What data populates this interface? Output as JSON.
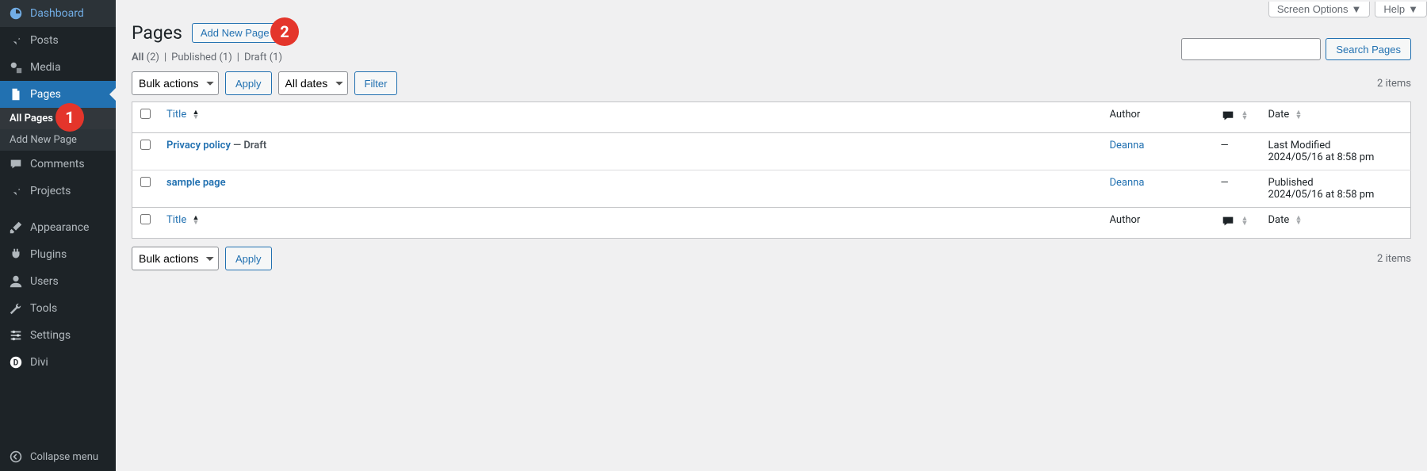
{
  "sidebar": {
    "items": [
      {
        "id": "dashboard",
        "label": "Dashboard",
        "icon": "dashboard-icon"
      },
      {
        "id": "posts",
        "label": "Posts",
        "icon": "pin-icon"
      },
      {
        "id": "media",
        "label": "Media",
        "icon": "media-icon"
      },
      {
        "id": "pages",
        "label": "Pages",
        "icon": "page-icon"
      },
      {
        "id": "comments",
        "label": "Comments",
        "icon": "comment-icon"
      },
      {
        "id": "projects",
        "label": "Projects",
        "icon": "pin-icon"
      },
      {
        "id": "appearance",
        "label": "Appearance",
        "icon": "brush-icon"
      },
      {
        "id": "plugins",
        "label": "Plugins",
        "icon": "plug-icon"
      },
      {
        "id": "users",
        "label": "Users",
        "icon": "user-icon"
      },
      {
        "id": "tools",
        "label": "Tools",
        "icon": "wrench-icon"
      },
      {
        "id": "settings",
        "label": "Settings",
        "icon": "settings-icon"
      },
      {
        "id": "divi",
        "label": "Divi",
        "icon": "divi-icon"
      }
    ],
    "submenu_pages": {
      "all_pages": "All Pages",
      "add_new": "Add New Page"
    },
    "collapse_label": "Collapse menu"
  },
  "annotations": {
    "badge1": "1",
    "badge2": "2"
  },
  "top_tabs": {
    "screen_options": "Screen Options",
    "help": "Help"
  },
  "header": {
    "title": "Pages",
    "add_new_label": "Add New Page"
  },
  "status_filters": {
    "all_label": "All",
    "all_count": "(2)",
    "published_label": "Published",
    "published_count": "(1)",
    "draft_label": "Draft",
    "draft_count": "(1)",
    "sep": "  |  "
  },
  "search": {
    "button_label": "Search Pages",
    "value": ""
  },
  "bulk": {
    "bulk_actions_label": "Bulk actions",
    "apply_label": "Apply",
    "all_dates_label": "All dates",
    "filter_label": "Filter"
  },
  "count_label": "2 items",
  "columns": {
    "title": "Title",
    "author": "Author",
    "date": "Date"
  },
  "rows": [
    {
      "title": "Privacy policy",
      "status_suffix": " — Draft",
      "author": "Deanna",
      "comments": "—",
      "date_line1": "Last Modified",
      "date_line2": "2024/05/16 at 8:58 pm"
    },
    {
      "title": "sample page",
      "status_suffix": "",
      "author": "Deanna",
      "comments": "—",
      "date_line1": "Published",
      "date_line2": "2024/05/16 at 8:58 pm"
    }
  ]
}
